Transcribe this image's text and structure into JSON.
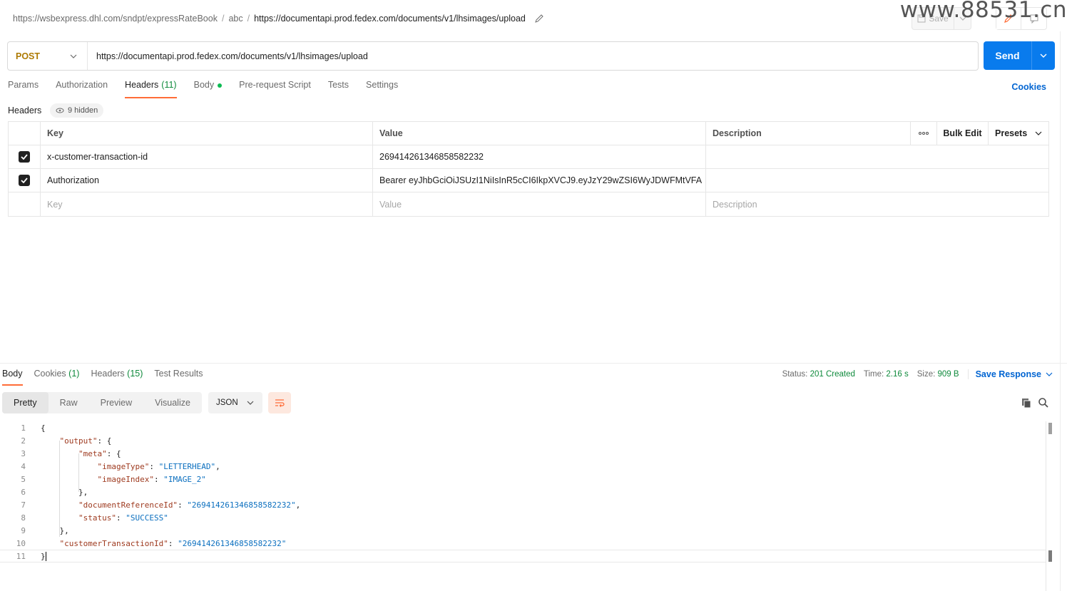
{
  "breadcrumb": {
    "items": [
      "https://wsbexpress.dhl.com/sndpt/expressRateBook",
      "abc"
    ],
    "current": "https://documentapi.prod.fedex.com/documents/v1/lhsimages/upload",
    "separator": "/"
  },
  "toolbar": {
    "save_label": "Save"
  },
  "watermark": "www.88531.cn",
  "request": {
    "method": "POST",
    "url": "https://documentapi.prod.fedex.com/documents/v1/lhsimages/upload",
    "send_label": "Send"
  },
  "tabs": {
    "params": "Params",
    "authorization": "Authorization",
    "headers": "Headers",
    "headers_count": "(11)",
    "body": "Body",
    "prerequest": "Pre-request Script",
    "tests": "Tests",
    "settings": "Settings",
    "cookies": "Cookies"
  },
  "headers_section": {
    "title": "Headers",
    "hidden": "9 hidden",
    "columns": {
      "key": "Key",
      "value": "Value",
      "description": "Description",
      "bulk_edit": "Bulk Edit",
      "presets": "Presets"
    },
    "rows": [
      {
        "key": "x-customer-transaction-id",
        "value": "269414261346858582232"
      },
      {
        "key": "Authorization",
        "value": "Bearer eyJhbGciOiJSUzI1NiIsInR5cCI6IkpXVCJ9.eyJzY29wZSI6WyJDWFMtVFA"
      }
    ],
    "placeholders": {
      "key": "Key",
      "value": "Value",
      "description": "Description"
    }
  },
  "response": {
    "tabs": {
      "body": "Body",
      "cookies": "Cookies",
      "cookies_count": "(1)",
      "headers": "Headers",
      "headers_count": "(15)",
      "test_results": "Test Results"
    },
    "status_label": "Status:",
    "status_value": "201 Created",
    "time_label": "Time:",
    "time_value": "2.16 s",
    "size_label": "Size:",
    "size_value": "909 B",
    "save_response": "Save Response",
    "views": [
      "Pretty",
      "Raw",
      "Preview",
      "Visualize"
    ],
    "format": "JSON",
    "line_numbers": [
      "1",
      "2",
      "3",
      "4",
      "5",
      "6",
      "7",
      "8",
      "9",
      "10",
      "11"
    ],
    "json": {
      "open": "{",
      "output_key": "\"output\"",
      "meta_key": "\"meta\"",
      "imageType_key": "\"imageType\"",
      "imageType_val": "\"LETTERHEAD\"",
      "imageIndex_key": "\"imageIndex\"",
      "imageIndex_val": "\"IMAGE_2\"",
      "docref_key": "\"documentReferenceId\"",
      "docref_val": "\"269414261346858582232\"",
      "status_key": "\"status\"",
      "status_val": "\"SUCCESS\"",
      "ctid_key": "\"customerTransactionId\"",
      "ctid_val": "\"269414261346858582232\"",
      "close": "}"
    }
  },
  "colors": {
    "accent": "#ff6c37",
    "send": "#097bed",
    "link": "#0265d2",
    "success": "#0f8a3c"
  }
}
